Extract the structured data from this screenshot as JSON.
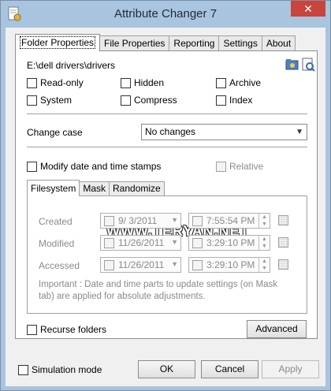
{
  "window": {
    "title": "Attribute Changer 7",
    "close_label": "✕"
  },
  "tabs": [
    "Folder Properties",
    "File Properties",
    "Reporting",
    "Settings",
    "About"
  ],
  "path": "E:\\dell drivers\\drivers",
  "attributes": {
    "read_only": "Read-only",
    "hidden": "Hidden",
    "archive": "Archive",
    "system": "System",
    "compress": "Compress",
    "index": "Index"
  },
  "change_case": {
    "label": "Change case",
    "value": "No changes"
  },
  "timestamps": {
    "modify_label": "Modify date and time stamps",
    "relative_label": "Relative"
  },
  "inner_tabs": [
    "Filesystem",
    "Mask",
    "Randomize"
  ],
  "rows": [
    {
      "label": "Created",
      "date": "9/ 3/2011",
      "time": "7:55:54 PM"
    },
    {
      "label": "Modified",
      "date": "11/26/2011",
      "time": "3:29:10 PM"
    },
    {
      "label": "Accessed",
      "date": "11/26/2011",
      "time": "3:29:10 PM"
    }
  ],
  "note": "Important : Date and time parts to update settings (on Mask tab) are applied for absolute adjustments.",
  "watermark": "WWW.TERYAN.NET",
  "recurse_label": "Recurse folders",
  "advanced_label": "Advanced",
  "footer": {
    "simulation_label": "Simulation mode",
    "ok": "OK",
    "cancel": "Cancel",
    "apply": "Apply"
  },
  "colors": {
    "title_bg": "#a9c4de",
    "close_bg": "#c7453c"
  }
}
